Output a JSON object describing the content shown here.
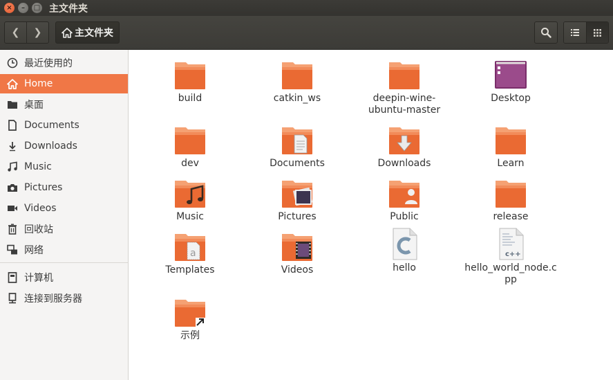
{
  "window": {
    "title": "主文件夹",
    "close_glyph": "×",
    "min_glyph": "–",
    "max_glyph": "□"
  },
  "toolbar": {
    "back_glyph": "❮",
    "forward_glyph": "❯",
    "path_label": "主文件夹"
  },
  "sidebar": {
    "items": [
      {
        "label": "最近使用的",
        "icon": "clock-icon"
      },
      {
        "label": "Home",
        "icon": "home-icon",
        "active": true
      },
      {
        "label": "桌面",
        "icon": "folder-icon"
      },
      {
        "label": "Documents",
        "icon": "document-icon"
      },
      {
        "label": "Downloads",
        "icon": "download-icon"
      },
      {
        "label": "Music",
        "icon": "music-icon"
      },
      {
        "label": "Pictures",
        "icon": "camera-icon"
      },
      {
        "label": "Videos",
        "icon": "video-icon"
      },
      {
        "label": "回收站",
        "icon": "trash-icon"
      },
      {
        "label": "网络",
        "icon": "network-icon"
      },
      {
        "label": "计算机",
        "icon": "computer-icon"
      },
      {
        "label": "连接到服务器",
        "icon": "server-icon"
      }
    ]
  },
  "files": [
    {
      "label": "build",
      "type": "folder"
    },
    {
      "label": "catkin_ws",
      "type": "folder"
    },
    {
      "label": "deepin-wine-ubuntu-master",
      "type": "folder"
    },
    {
      "label": "Desktop",
      "type": "desktop"
    },
    {
      "label": "dev",
      "type": "folder"
    },
    {
      "label": "Documents",
      "type": "folder-documents"
    },
    {
      "label": "Downloads",
      "type": "folder-downloads"
    },
    {
      "label": "Learn",
      "type": "folder"
    },
    {
      "label": "Music",
      "type": "folder-music"
    },
    {
      "label": "Pictures",
      "type": "folder-pictures"
    },
    {
      "label": "Public",
      "type": "folder-public"
    },
    {
      "label": "release",
      "type": "folder"
    },
    {
      "label": "Templates",
      "type": "folder-templates"
    },
    {
      "label": "Videos",
      "type": "folder-videos"
    },
    {
      "label": "hello",
      "type": "file-c"
    },
    {
      "label": "hello_world_node.cpp",
      "type": "file-cpp"
    },
    {
      "label": "示例",
      "type": "folder-link"
    }
  ],
  "colors": {
    "accent": "#f07746",
    "titlebar": "#3c3b37",
    "folder_top": "#f79b6c",
    "folder_body": "#e9612c"
  }
}
